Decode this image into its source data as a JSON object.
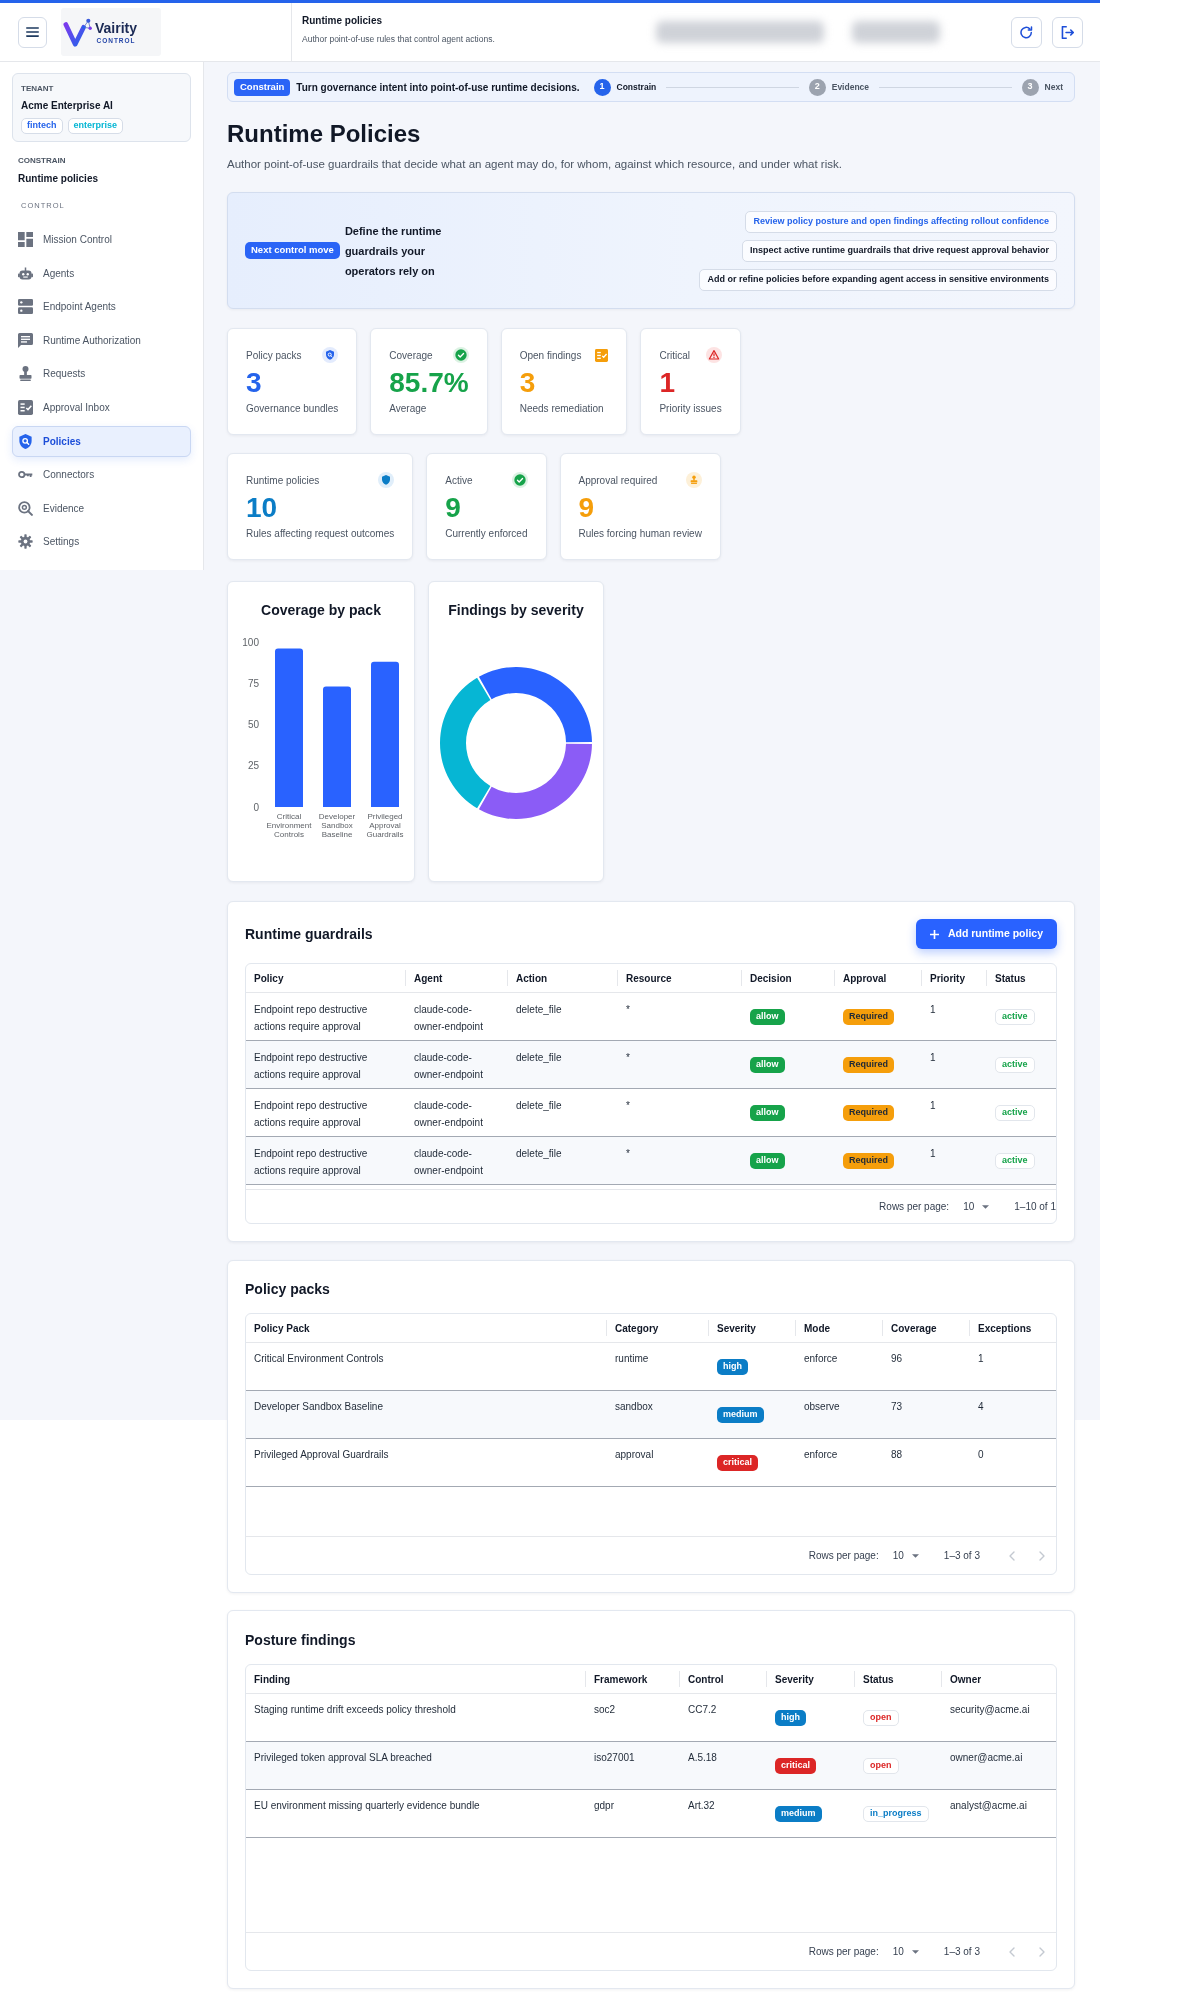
{
  "header": {
    "logo": {
      "name": "Vairity",
      "tagline": "CONTROL"
    },
    "title": "Runtime policies",
    "subtitle": "Author point-of-use rules that control agent actions."
  },
  "sidebar": {
    "tenant": {
      "label": "TENANT",
      "name": "Acme Enterprise AI",
      "tags": [
        {
          "text": "fintech",
          "color": "#2563eb"
        },
        {
          "text": "enterprise",
          "color": "#06b6d4"
        }
      ]
    },
    "section_label": "CONSTRAIN",
    "section_title": "Runtime policies",
    "group_label": "CONTROL",
    "items": [
      {
        "label": "Mission Control",
        "selected": false
      },
      {
        "label": "Agents",
        "selected": false
      },
      {
        "label": "Endpoint Agents",
        "selected": false
      },
      {
        "label": "Runtime Authorization",
        "selected": false
      },
      {
        "label": "Requests",
        "selected": false
      },
      {
        "label": "Approval Inbox",
        "selected": false
      },
      {
        "label": "Policies",
        "selected": true
      },
      {
        "label": "Connectors",
        "selected": false
      },
      {
        "label": "Evidence",
        "selected": false
      },
      {
        "label": "Settings",
        "selected": false
      }
    ]
  },
  "stepper": {
    "stage": "Constrain",
    "text": "Turn governance intent into point-of-use runtime decisions.",
    "steps": [
      {
        "number": "1",
        "label": "Constrain",
        "active": true
      },
      {
        "number": "2",
        "label": "Evidence",
        "active": false
      },
      {
        "number": "3",
        "label": "Next",
        "active": false
      }
    ]
  },
  "page": {
    "title": "Runtime Policies",
    "subtitle": "Author point-of-use guardrails that decide what an agent may do, for whom, against which resource, and under what risk."
  },
  "hero": {
    "tag": "Next control move",
    "heading": "Define the runtime guardrails your operators rely on",
    "actions": [
      {
        "label": "Review policy posture and open findings affecting rollout confidence",
        "selected": true
      },
      {
        "label": "Inspect active runtime guardrails that drive request approval behavior",
        "selected": false
      },
      {
        "label": "Add or refine policies before expanding agent access in sensitive environments",
        "selected": false
      }
    ]
  },
  "stat_rows": [
    [
      {
        "label": "Policy packs",
        "value": "3",
        "caption": "Governance bundles",
        "color": "#2563eb"
      },
      {
        "label": "Coverage",
        "value": "85.7%",
        "caption": "Average",
        "color": "#16a34a"
      },
      {
        "label": "Open findings",
        "value": "3",
        "caption": "Needs remediation",
        "color": "#f59e0b"
      },
      {
        "label": "Critical",
        "value": "1",
        "caption": "Priority issues",
        "color": "#dc2626"
      }
    ],
    [
      {
        "label": "Runtime policies",
        "value": "10",
        "caption": "Rules affecting request outcomes",
        "color": "#0b7dc6"
      },
      {
        "label": "Active",
        "value": "9",
        "caption": "Currently enforced",
        "color": "#16a34a"
      },
      {
        "label": "Approval required",
        "value": "9",
        "caption": "Rules forcing human review",
        "color": "#f59e0b"
      }
    ]
  ],
  "charts": [
    {
      "kind": "bar",
      "chart_data": {
        "type": "bar",
        "title": "Coverage by pack",
        "categories": [
          "Critical Environment Controls",
          "Developer Sandbox Baseline",
          "Privileged Approval Guardrails"
        ],
        "values": [
          96,
          73,
          88
        ],
        "ylim": [
          0,
          100
        ],
        "yticks": [
          0,
          25,
          50,
          75,
          100
        ]
      }
    },
    {
      "kind": "donut",
      "title": "Findings by severity"
    }
  ],
  "guardrails": {
    "title": "Runtime guardrails",
    "add_button": "Add runtime policy",
    "columns": [
      {
        "label": "Policy",
        "kind": "text"
      },
      {
        "label": "Agent",
        "kind": "text"
      },
      {
        "label": "Action",
        "kind": "text"
      },
      {
        "label": "Resource",
        "kind": "text"
      },
      {
        "label": "Decision",
        "kind": "filled_badge"
      },
      {
        "label": "Approval",
        "kind": "filled_badge"
      },
      {
        "label": "Priority",
        "kind": "text"
      },
      {
        "label": "Status",
        "kind": "outlined_badge"
      }
    ],
    "rows": [
      [
        "Endpoint repo destructive actions require approval",
        "claude-code-owner-endpoint",
        "delete_file",
        "*",
        {
          "text": "allow",
          "color": "#16a34a"
        },
        {
          "text": "Required",
          "color": "#f59e0b"
        },
        "1",
        {
          "text": "active",
          "color": "#16a34a"
        }
      ],
      [
        "Endpoint repo destructive actions require approval",
        "claude-code-owner-endpoint",
        "delete_file",
        "*",
        {
          "text": "allow",
          "color": "#16a34a"
        },
        {
          "text": "Required",
          "color": "#f59e0b"
        },
        "1",
        {
          "text": "active",
          "color": "#16a34a"
        }
      ],
      [
        "Endpoint repo destructive actions require approval",
        "claude-code-owner-endpoint",
        "delete_file",
        "*",
        {
          "text": "allow",
          "color": "#16a34a"
        },
        {
          "text": "Required",
          "color": "#f59e0b"
        },
        "1",
        {
          "text": "active",
          "color": "#16a34a"
        }
      ],
      [
        "Endpoint repo destructive actions require approval",
        "claude-code-owner-endpoint",
        "delete_file",
        "*",
        {
          "text": "allow",
          "color": "#16a34a"
        },
        {
          "text": "Required",
          "color": "#f59e0b"
        },
        "1",
        {
          "text": "active",
          "color": "#16a34a"
        }
      ]
    ],
    "pagination": {
      "rows_label": "Rows per page:",
      "rows_value": "10",
      "range": "1–10 of 1"
    }
  },
  "policy_packs": {
    "title": "Policy packs",
    "columns": [
      {
        "label": "Policy Pack",
        "kind": "text"
      },
      {
        "label": "Category",
        "kind": "text"
      },
      {
        "label": "Severity",
        "kind": "filled_badge"
      },
      {
        "label": "Mode",
        "kind": "text"
      },
      {
        "label": "Coverage",
        "kind": "text"
      },
      {
        "label": "Exceptions",
        "kind": "text"
      }
    ],
    "rows": [
      [
        "Critical Environment Controls",
        "runtime",
        {
          "text": "high",
          "color": "#0b7dc6"
        },
        "enforce",
        "96",
        "1"
      ],
      [
        "Developer Sandbox Baseline",
        "sandbox",
        {
          "text": "medium",
          "color": "#0b7dc6"
        },
        "observe",
        "73",
        "4"
      ],
      [
        "Privileged Approval Guardrails",
        "approval",
        {
          "text": "critical",
          "color": "#dc2626"
        },
        "enforce",
        "88",
        "0"
      ]
    ],
    "pagination": {
      "rows_label": "Rows per page:",
      "rows_value": "10",
      "range": "1–3 of 3",
      "arrows": [
        {
          "disabled": true
        },
        {
          "disabled": true
        }
      ]
    }
  },
  "posture_findings": {
    "title": "Posture findings",
    "columns": [
      {
        "label": "Finding",
        "kind": "text"
      },
      {
        "label": "Framework",
        "kind": "text"
      },
      {
        "label": "Control",
        "kind": "text"
      },
      {
        "label": "Severity",
        "kind": "filled_badge"
      },
      {
        "label": "Status",
        "kind": "outlined_badge"
      },
      {
        "label": "Owner",
        "kind": "text"
      }
    ],
    "rows": [
      [
        "Staging runtime drift exceeds policy threshold",
        "soc2",
        "CC7.2",
        {
          "text": "high",
          "color": "#0b7dc6"
        },
        {
          "text": "open",
          "color": "#dc2626"
        },
        "security@acme.ai"
      ],
      [
        "Privileged token approval SLA breached",
        "iso27001",
        "A.5.18",
        {
          "text": "critical",
          "color": "#dc2626"
        },
        {
          "text": "open",
          "color": "#dc2626"
        },
        "owner@acme.ai"
      ],
      [
        "EU environment missing quarterly evidence bundle",
        "gdpr",
        "Art.32",
        {
          "text": "medium",
          "color": "#0b7dc6"
        },
        {
          "text": "in_progress",
          "color": "#0b7dc6"
        },
        "analyst@acme.ai"
      ]
    ],
    "pagination": {
      "rows_label": "Rows per page:",
      "rows_value": "10",
      "range": "1–3 of 3",
      "arrows": [
        {
          "disabled": true
        },
        {
          "disabled": true
        }
      ]
    }
  }
}
